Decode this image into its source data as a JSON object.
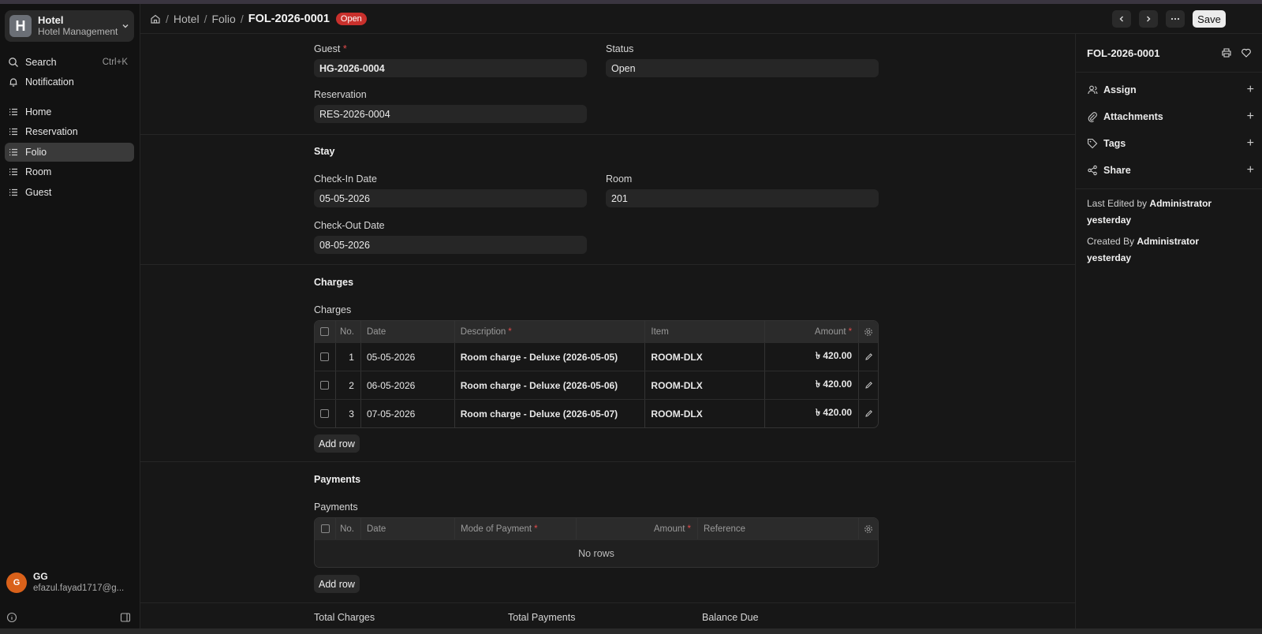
{
  "workspace": {
    "logo_letter": "H",
    "title": "Hotel",
    "subtitle": "Hotel Management"
  },
  "sidebar": {
    "search_label": "Search",
    "search_shortcut": "Ctrl+K",
    "notification_label": "Notification",
    "items": [
      {
        "label": "Home"
      },
      {
        "label": "Reservation"
      },
      {
        "label": "Folio",
        "active": true
      },
      {
        "label": "Room"
      },
      {
        "label": "Guest"
      }
    ],
    "user": {
      "initial": "G",
      "name": "GG",
      "email": "efazul.fayad1717@g..."
    }
  },
  "header": {
    "breadcrumb": [
      "Hotel",
      "Folio"
    ],
    "current": "FOL-2026-0001",
    "status_badge": "Open",
    "save_label": "Save"
  },
  "form": {
    "guest": {
      "label": "Guest",
      "value": "HG-2026-0004"
    },
    "status": {
      "label": "Status",
      "value": "Open"
    },
    "reservation": {
      "label": "Reservation",
      "value": "RES-2026-0004"
    },
    "stay": {
      "title": "Stay",
      "check_in": {
        "label": "Check-In Date",
        "value": "05-05-2026"
      },
      "room": {
        "label": "Room",
        "value": "201"
      },
      "check_out": {
        "label": "Check-Out Date",
        "value": "08-05-2026"
      }
    },
    "charges": {
      "title": "Charges",
      "table_label": "Charges",
      "columns": {
        "no": "No.",
        "date": "Date",
        "description": "Description",
        "item": "Item",
        "amount": "Amount"
      },
      "rows": [
        {
          "no": "1",
          "date": "05-05-2026",
          "description": "Room charge - Deluxe (2026-05-05)",
          "item": "ROOM-DLX",
          "amount": "৳ 420.00"
        },
        {
          "no": "2",
          "date": "06-05-2026",
          "description": "Room charge - Deluxe (2026-05-06)",
          "item": "ROOM-DLX",
          "amount": "৳ 420.00"
        },
        {
          "no": "3",
          "date": "07-05-2026",
          "description": "Room charge - Deluxe (2026-05-07)",
          "item": "ROOM-DLX",
          "amount": "৳ 420.00"
        }
      ],
      "add_row_label": "Add row"
    },
    "payments": {
      "title": "Payments",
      "table_label": "Payments",
      "columns": {
        "no": "No.",
        "date": "Date",
        "mode": "Mode of Payment",
        "amount": "Amount",
        "reference": "Reference"
      },
      "empty_text": "No rows",
      "add_row_label": "Add row"
    },
    "totals": {
      "total_charges": "Total Charges",
      "total_payments": "Total Payments",
      "balance_due": "Balance Due"
    }
  },
  "right_panel": {
    "title": "FOL-2026-0001",
    "actions": [
      {
        "label": "Assign",
        "icon": "user-icon"
      },
      {
        "label": "Attachments",
        "icon": "paperclip-icon"
      },
      {
        "label": "Tags",
        "icon": "tag-icon"
      },
      {
        "label": "Share",
        "icon": "share-icon"
      }
    ],
    "last_edited_prefix": "Last Edited by",
    "last_edited_by": "Administrator",
    "last_edited_when": "yesterday",
    "created_prefix": "Created By",
    "created_by": "Administrator",
    "created_when": "yesterday"
  }
}
